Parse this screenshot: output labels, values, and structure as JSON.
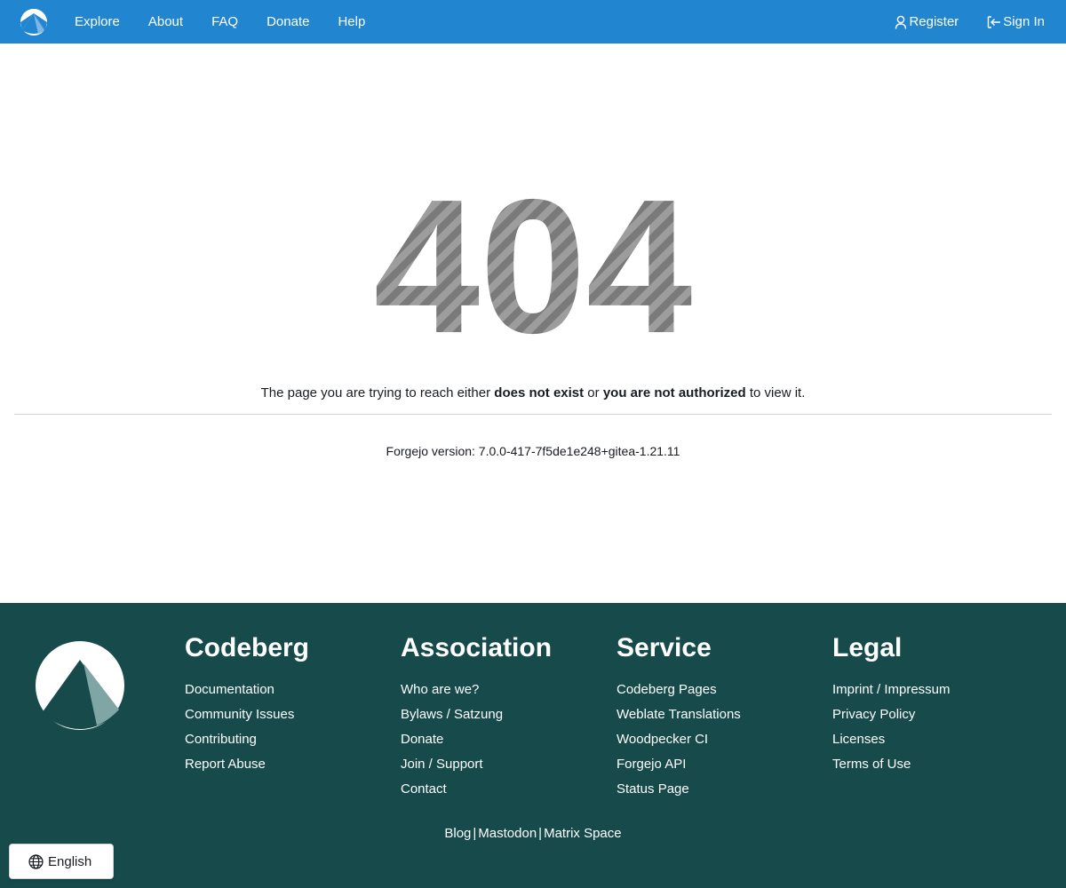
{
  "nav": {
    "logo_icon": "codeberg-logo-icon",
    "items": [
      "Explore",
      "About",
      "FAQ",
      "Donate",
      "Help"
    ],
    "register_label": "Register",
    "register_icon": "person-icon",
    "signin_label": "Sign In",
    "signin_icon": "sign-in-icon",
    "background_color": "#2185d0"
  },
  "error": {
    "code": "404",
    "message_prefix": "The page you are trying to reach either ",
    "message_bold1": "does not exist",
    "message_middle": " or ",
    "message_bold2": "you are not authorized",
    "message_suffix": " to view it."
  },
  "version_text": "Forgejo version: 7.0.0-417-7f5de1e248+gitea-1.21.11",
  "footer": {
    "background_color": "#174a4a",
    "columns": [
      {
        "title": "Codeberg",
        "links": [
          "Documentation",
          "Community Issues",
          "Contributing",
          "Report Abuse"
        ]
      },
      {
        "title": "Association",
        "links": [
          "Who are we?",
          "Bylaws / Satzung",
          "Donate",
          "Join / Support",
          "Contact"
        ]
      },
      {
        "title": "Service",
        "links": [
          "Codeberg Pages",
          "Weblate Translations",
          "Woodpecker CI",
          "Forgejo API",
          "Status Page"
        ]
      },
      {
        "title": "Legal",
        "links": [
          "Imprint / Impressum",
          "Privacy Policy",
          "Licenses",
          "Terms of Use"
        ]
      }
    ],
    "bottom_links": [
      "Blog",
      "Mastodon",
      "Matrix Space"
    ],
    "separator": "|"
  },
  "language": {
    "label": "English",
    "icon": "globe-icon"
  }
}
